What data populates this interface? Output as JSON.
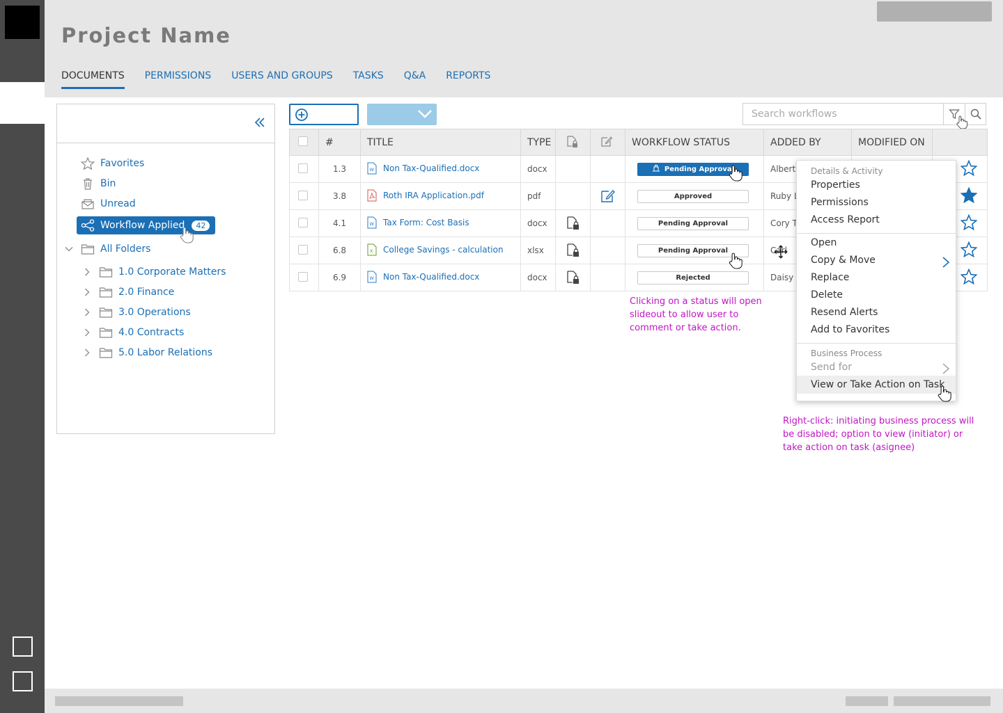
{
  "header": {
    "project_title": "Project Name",
    "tabs": [
      {
        "label": "DOCUMENTS",
        "active": true
      },
      {
        "label": "PERMISSIONS"
      },
      {
        "label": "USERS AND GROUPS"
      },
      {
        "label": "TASKS"
      },
      {
        "label": "Q&A"
      },
      {
        "label": "REPORTS"
      }
    ]
  },
  "sidebar": {
    "items": [
      {
        "label": "Favorites",
        "icon": "star-icon"
      },
      {
        "label": "Bin",
        "icon": "trash-icon"
      },
      {
        "label": "Unread",
        "icon": "envelope-icon"
      },
      {
        "label": "Workflow Applied",
        "icon": "share-icon",
        "count": "42",
        "selected": true
      }
    ],
    "all_folders": "All Folders",
    "folders": [
      "1.0 Corporate Matters",
      "2.0 Finance",
      "3.0 Operations",
      "4.0 Contracts",
      "5.0 Labor Relations"
    ]
  },
  "search": {
    "placeholder": "Search workflows"
  },
  "table": {
    "columns": [
      "#",
      "TITLE",
      "TYPE",
      "WORKFLOW STATUS",
      "ADDED BY",
      "MODIFIED ON"
    ],
    "rows": [
      {
        "num": "1.3",
        "title": "Non Tax-Qualified.docx",
        "file_icon": "word-file-icon",
        "type": "docx",
        "status": "Pending Approval",
        "added_by": "Alberta",
        "favorite": false
      },
      {
        "num": "3.8",
        "title": "Roth IRA Application.pdf",
        "file_icon": "pdf-file-icon",
        "type": "pdf",
        "status": "Approved",
        "added_by": "Ruby L",
        "favorite": true
      },
      {
        "num": "4.1",
        "title": "Tax Form: Cost Basis",
        "file_icon": "word-file-icon",
        "type": "docx",
        "status": "Pending Approval",
        "added_by": "Cory Ty",
        "favorite": false
      },
      {
        "num": "6.8",
        "title": "College Savings - calculation",
        "file_icon": "excel-file-icon",
        "type": "xlsx",
        "status": "Pending Approval",
        "added_by": "Carl",
        "favorite": false
      },
      {
        "num": "6.9",
        "title": "Non Tax-Qualified.docx",
        "file_icon": "word-file-icon",
        "type": "docx",
        "status": "Rejected",
        "added_by": "Daisy S",
        "favorite": false
      }
    ]
  },
  "context_menu": {
    "section1": "Details & Activity",
    "items1": [
      "Properties",
      "Permissions",
      "Access Report"
    ],
    "items2": [
      "Open",
      "Copy & Move",
      "Replace",
      "Delete",
      "Resend Alerts",
      "Add to Favorites"
    ],
    "section3": "Business Process",
    "send_for": "Send for",
    "view_task": "View or Take Action on Task"
  },
  "notes": {
    "status_note": "Clicking on a status will open slideout to allow user to comment or take action.",
    "rightclick_note": "Right-click: initiating business process will be disabled; option to view (initiator) or take action on task (asignee)"
  },
  "colors": {
    "accent": "#1a6fb5",
    "annotation": "#c015c4",
    "header_bg": "#e6e6e6",
    "rail": "#4a4a4a"
  }
}
